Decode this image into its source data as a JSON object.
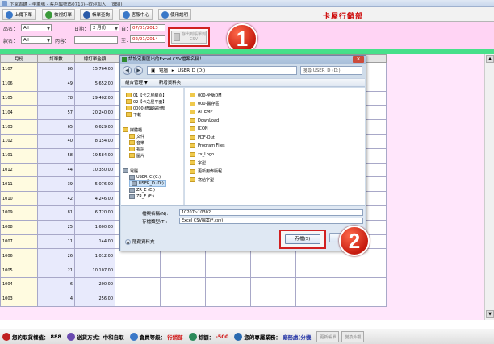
{
  "window": {
    "title": "卞家香舖 - 李薰珮 - 客戶編號(50713)--歡迎加入！(888)"
  },
  "toolbar": {
    "buttons": [
      {
        "label": "上傳下單",
        "name": "upload-order-button",
        "icon_color": "#3a78c8"
      },
      {
        "label": "檢視訂單",
        "name": "view-orders-button",
        "icon_color": "#3a9a3a"
      },
      {
        "label": "帳單查詢",
        "name": "bill-query-button",
        "icon_color": "#2a5aa8"
      },
      {
        "label": "客服中心",
        "name": "service-center-button",
        "icon_color": "#3a78c8"
      },
      {
        "label": "使用說明",
        "name": "help-button",
        "icon_color": "#3a78c8"
      }
    ],
    "brand": "卡屋行銷部"
  },
  "filters": {
    "product_label": "品名：",
    "product_value": "All",
    "date_label": "日期：",
    "date_value": "2 月份",
    "from_label": "自：",
    "from_value": "07/01/2013",
    "to_label": "至：",
    "to_value": "02/21/2014",
    "type_label": "款名：",
    "type_value": "All",
    "content_label": "內容："
  },
  "export_button": {
    "label": "存出到帳單到 CSV"
  },
  "badges": {
    "one": "1",
    "two": "2"
  },
  "grid": {
    "columns": [
      "月份",
      "訂單數",
      "總訂單金額"
    ],
    "rows": [
      [
        "1107",
        "86",
        "15,764.00"
      ],
      [
        "1106",
        "49",
        "5,652.00"
      ],
      [
        "1105",
        "78",
        "29,402.00"
      ],
      [
        "1104",
        "57",
        "20,240.00"
      ],
      [
        "1103",
        "65",
        "6,629.00"
      ],
      [
        "1102",
        "40",
        "8,154.00"
      ],
      [
        "1101",
        "58",
        "19,584.00"
      ],
      [
        "1012",
        "44",
        "10,350.00"
      ],
      [
        "1011",
        "39",
        "5,076.00"
      ],
      [
        "1010",
        "42",
        "4,246.00"
      ],
      [
        "1009",
        "81",
        "6,720.00"
      ],
      [
        "1008",
        "25",
        "1,600.00"
      ],
      [
        "1007",
        "11",
        "144.00"
      ],
      [
        "1006",
        "26",
        "1,012.00"
      ],
      [
        "1005",
        "21",
        "10,107.00"
      ],
      [
        "1004",
        "6",
        "200.00"
      ],
      [
        "1003",
        "4",
        "256.00"
      ]
    ]
  },
  "dialog": {
    "title": "請設定要匯出的Excel CSV檔案名稱！",
    "address_segments": [
      "電腦",
      "USER_D (D:)"
    ],
    "search_placeholder": "搜尋 USER_D (D:)",
    "tools": [
      "組合管理 ▼",
      "新增資料夾"
    ],
    "nav_items": [
      {
        "label": "01【卡之屋網頁】",
        "kind": "folder"
      },
      {
        "label": "02【卡之屋平面】",
        "kind": "folder"
      },
      {
        "label": "0000-統籌設計部",
        "kind": "folder"
      },
      {
        "label": "下載",
        "kind": "folder"
      },
      {
        "label": "媒體櫃",
        "kind": "folder"
      },
      {
        "label": "文件",
        "kind": "folder"
      },
      {
        "label": "音樂",
        "kind": "folder"
      },
      {
        "label": "視訊",
        "kind": "folder"
      },
      {
        "label": "圖片",
        "kind": "folder"
      },
      {
        "label": "電腦",
        "kind": "drive"
      },
      {
        "label": "USER_C (C:)",
        "kind": "drive"
      },
      {
        "label": "USER_D (D:)",
        "kind": "drive"
      },
      {
        "label": "ZR_E (E:)",
        "kind": "drive"
      },
      {
        "label": "ZR_F (F:)",
        "kind": "drive"
      }
    ],
    "files": [
      "000-全版DM",
      "000-醫存區",
      "AITEMP",
      "DownLoad",
      "ICON",
      "PDF-Out",
      "Program Files",
      "zx_Logo",
      "字型",
      "更新用佈版程",
      "寫給字型"
    ],
    "filename_label": "檔案名稱(N):",
    "filename_value": "10207~10302",
    "type_label": "存檔類型(T):",
    "type_value": "Excel CSV檔案(*.csv)",
    "hide_folders_label": "隱藏資料夾",
    "save_label": "存檔(S)",
    "cancel_label": "取消"
  },
  "statusbar": {
    "points_label": "您的取貨權值：",
    "points_value": "888",
    "delivery_label": "送貨方式：中和自取",
    "level_label": "會員等級：",
    "level_value": "行銷部",
    "balance_label": "餘額：",
    "balance_value": "-500",
    "rep_label": "您的專屬業務：",
    "rep_value": "廠務處(分機",
    "btn1": "更新帳單",
    "btn2": "變換外觀"
  }
}
